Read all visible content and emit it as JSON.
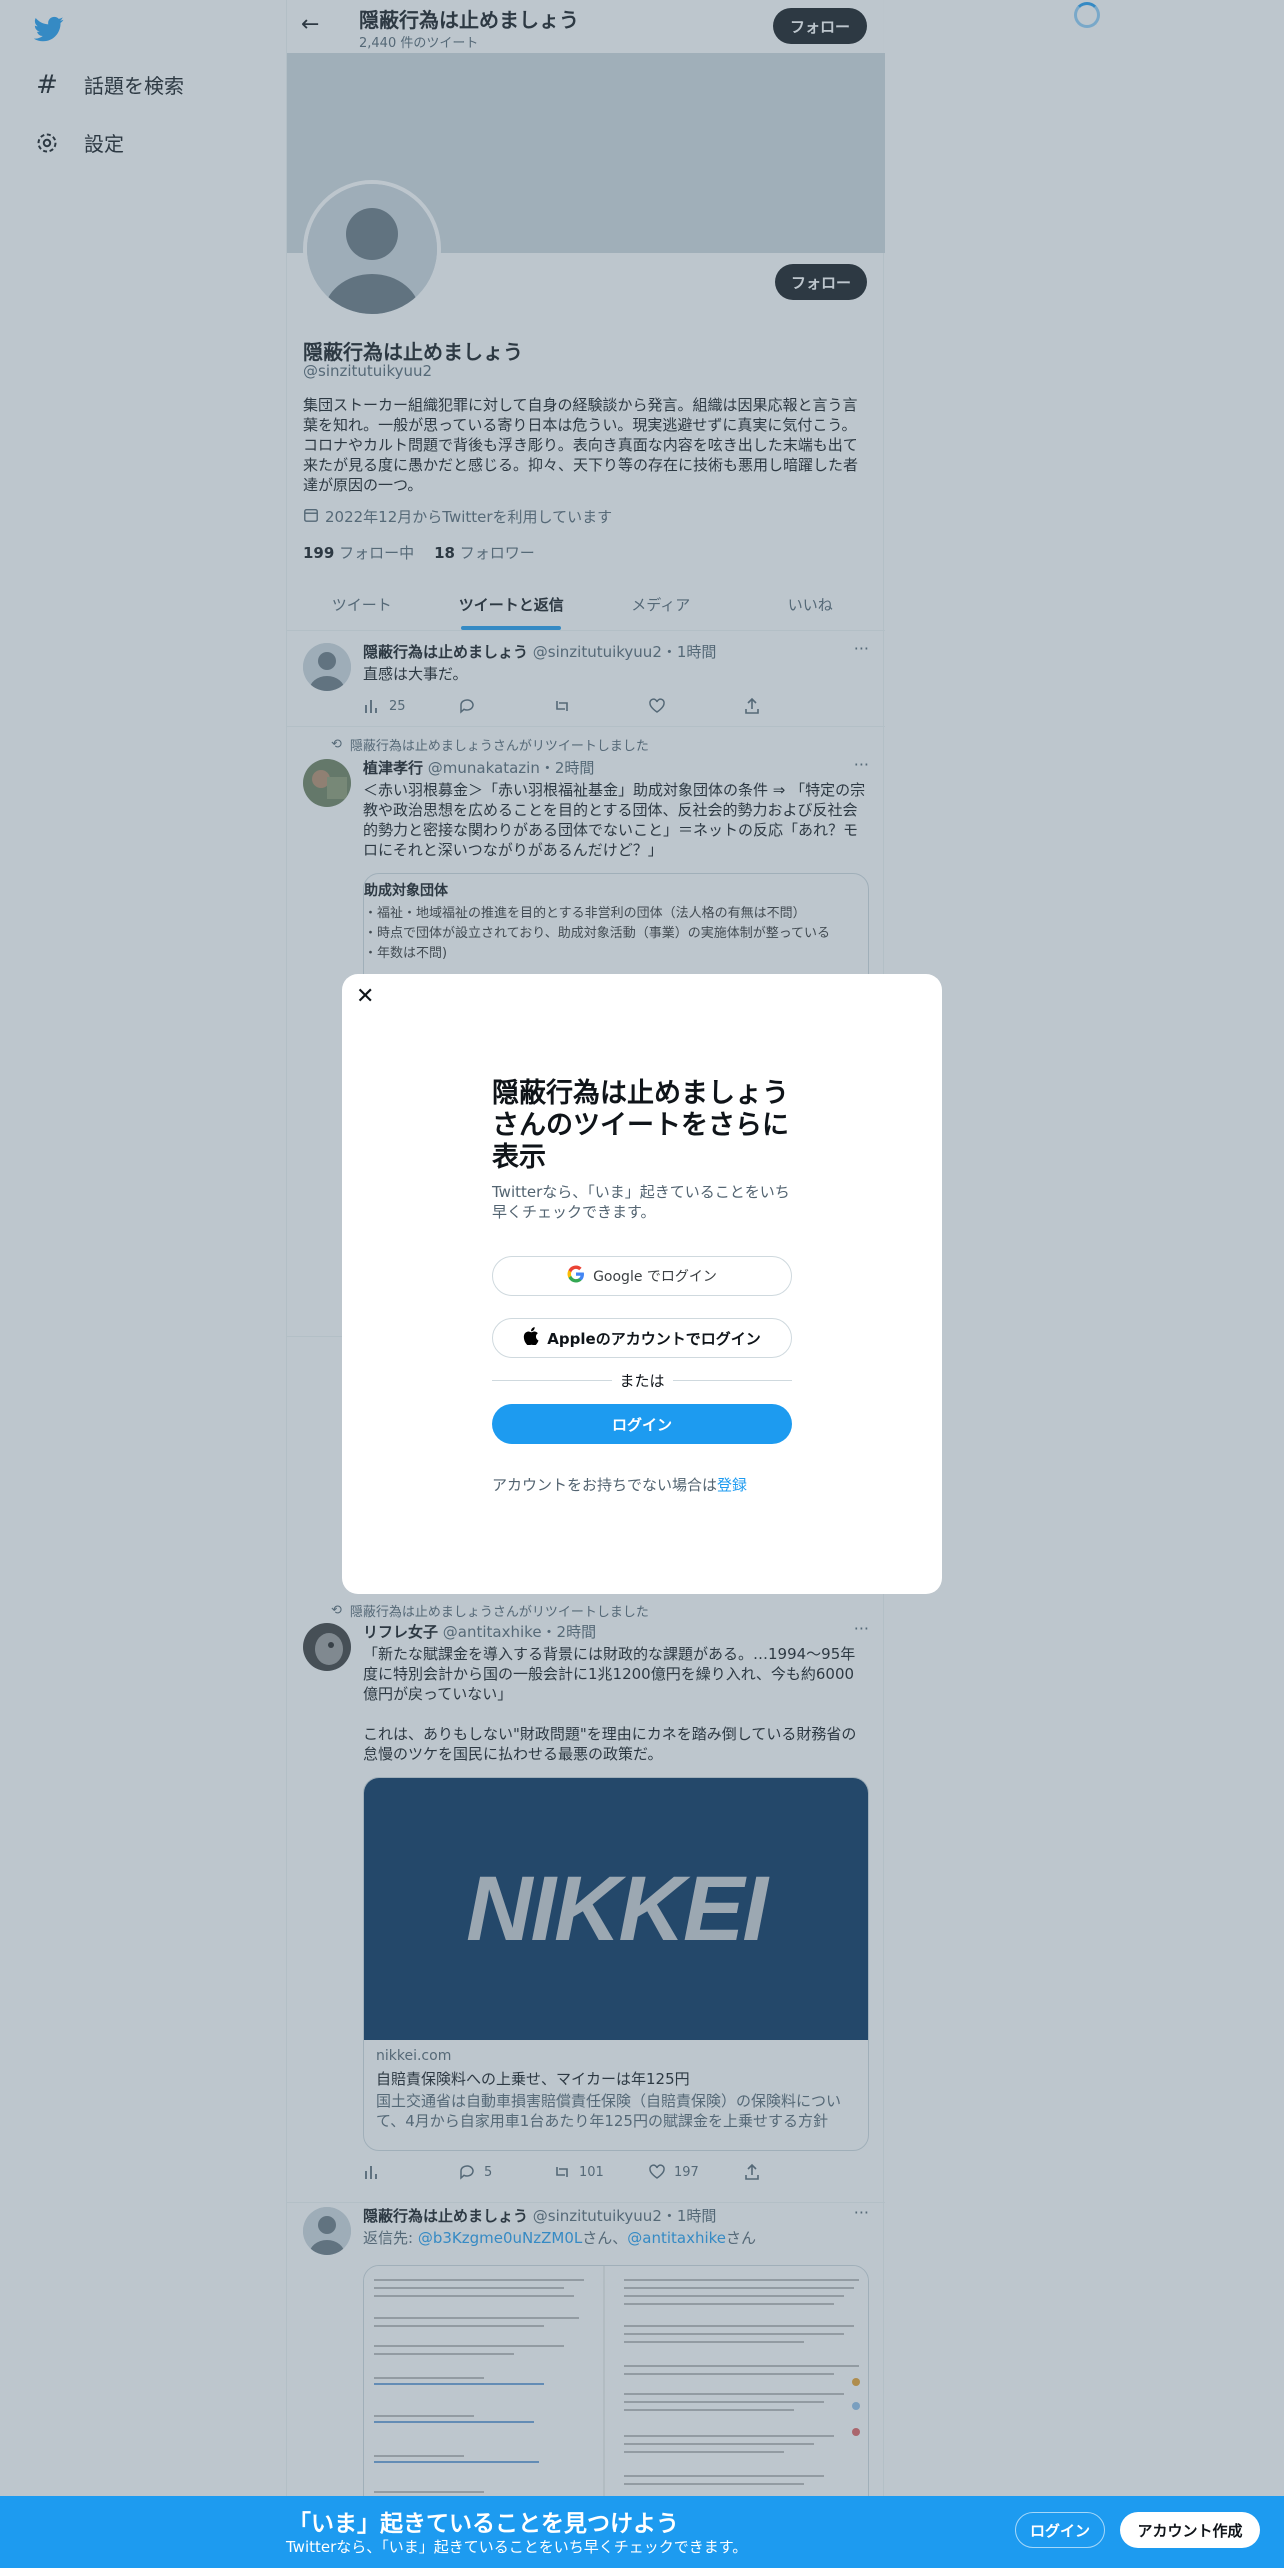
{
  "nav": {
    "explore": "話題を検索",
    "settings": "設定"
  },
  "header": {
    "title": "隠蔽行為は止めましょう",
    "tweet_count": "2,440 件のツイート",
    "follow": "フォロー"
  },
  "profile": {
    "name": "隠蔽行為は止めましょう",
    "handle": "@sinzitutuikyuu2",
    "follow": "フォロー",
    "bio": "集団ストーカー組織犯罪に対して自身の経験談から発言。組織は因果応報と言う言葉を知れ。一般が思っている寄り日本は危うい。現実逃避せずに真実に気付こう。コロナやカルト問題で背後も浮き彫り。表向き真面な内容を呟き出した末端も出て来たが見る度に愚かだと感じる。抑々、天下り等の存在に技術も悪用し暗躍した者達が原因の一つ。",
    "joined": "2022年12月からTwitterを利用しています",
    "following_count": "199",
    "following_label": "フォロー中",
    "followers_count": "18",
    "followers_label": "フォロワー"
  },
  "tabs": [
    "ツイート",
    "ツイートと返信",
    "メディア",
    "いいね"
  ],
  "tweets": [
    {
      "name": "隠蔽行為は止めましょう",
      "meta": "@sinzitutuikyuu2・1時間",
      "text": "直感は大事だ。",
      "views": "25"
    },
    {
      "retweet_label": "隠蔽行為は止めましょうさんがリツイートしました",
      "name": "植津孝行",
      "meta": "@munakatazin・2時間",
      "text": "＜赤い羽根募金＞「赤い羽根福祉基金」助成対象団体の条件 ⇒ 「特定の宗教や政治思想を広めることを目的とする団体、反社会的勢力および反社会的勢力と密接な関わりがある団体でないこと」＝ネットの反応「あれ？モロにそれと深いつながりがあるんだけど？」",
      "card_title": "助成対象団体",
      "card_line1": "・福祉・地域福祉の推進を目的とする非営利の団体（法人格の有無は不問）",
      "card_line2": "・時点で団体が設立されており、助成対象活動（事業）の実施体制が整っている",
      "card_line3": "・年数は不問)"
    },
    {
      "retweet_label": "隠蔽行為は止めましょうさんがリツイートしました",
      "name": "リフレ女子",
      "meta": "@antitaxhike・2時間",
      "text1": "「新たな賦課金を導入する背景には財政的な課題がある。…1994～95年度に特別会計から国の一般会計に1兆1200億円を繰り入れ、今も約6000億円が戻っていない」",
      "text2": "これは、ありもしない\"財政問題\"を理由にカネを踏み倒している財務省の怠慢のツケを国民に払わせる最悪の政策だ。",
      "card_logo": "NIKKEI",
      "card_domain": "nikkei.com",
      "card_title": "自賠責保険料への上乗せ、マイカーは年125円",
      "card_desc": "国土交通省は自動車損害賠償責任保険（自賠責保険）の保険料について、4月から自家用車1台あたり年125円の賦課金を上乗せする方針を…",
      "replies": "5",
      "retweets": "101",
      "likes": "197"
    },
    {
      "name": "隠蔽行為は止めましょう",
      "meta": "@sinzitutuikyuu2・1時間",
      "reply_prefix": "返信先: ",
      "reply_user1": "@b3Kzgme0uNzZM0L",
      "reply_mid": "さん、",
      "reply_user2": "@antitaxhike",
      "reply_suffix": "さん"
    }
  ],
  "modal": {
    "title": "隠蔽行為は止めましょうさんのツイートをさらに表示",
    "desc": "Twitterなら、「いま」起きていることをいち早くチェックできます。",
    "google": "Google でログイン",
    "apple": "Appleのアカウントでログイン",
    "or": "または",
    "login": "ログイン",
    "signup_prefix": "アカウントをお持ちでない場合は",
    "signup_link": "登録"
  },
  "bottom": {
    "title": "「いま」起きていることを見つけよう",
    "sub": "Twitterなら、「いま」起きていることをいち早くチェックできます。",
    "login": "ログイン",
    "signup": "アカウント作成"
  },
  "colors": {
    "accent": "#1d9bf0",
    "overlay": "#5b7083"
  }
}
